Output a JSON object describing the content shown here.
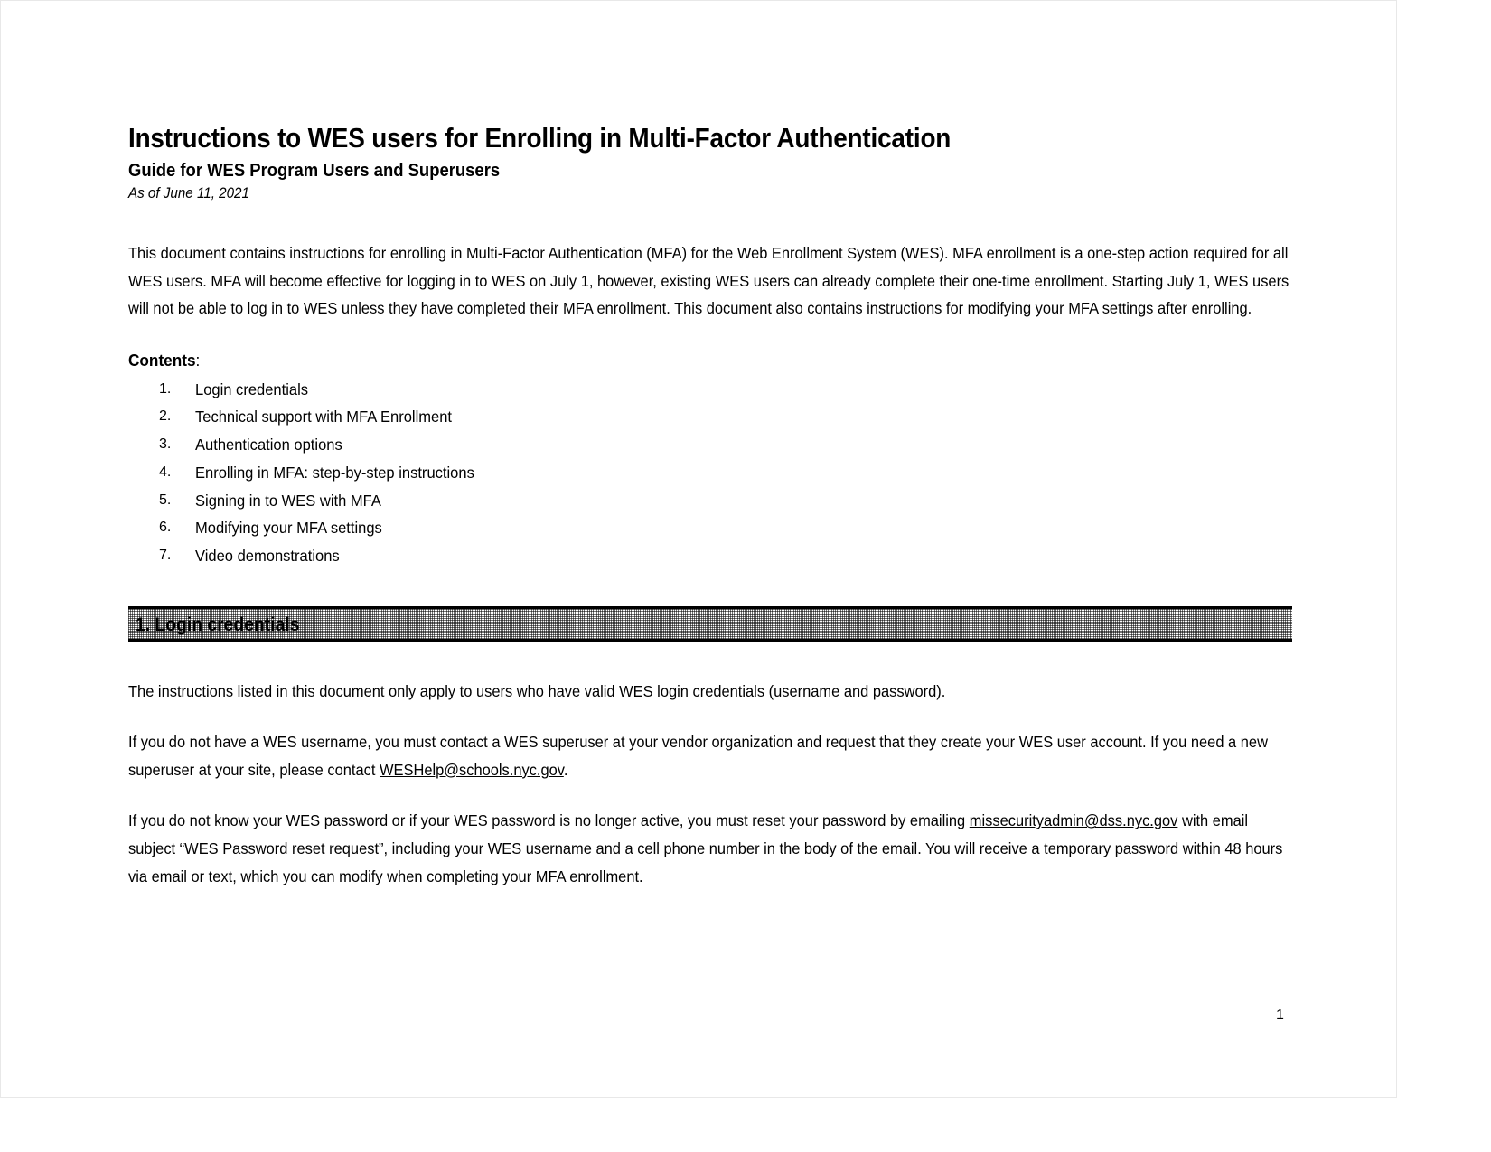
{
  "document": {
    "title": "Instructions to WES users for Enrolling in Multi-Factor Authentication",
    "subtitle": "Guide for WES Program Users and Superusers",
    "date_line": "As of June 11, 2021",
    "intro_paragraph": "This document contains instructions for enrolling in Multi-Factor Authentication (MFA) for the Web Enrollment System (WES). MFA enrollment is a one-step action required for all WES users. MFA will become effective for logging in to WES on July 1, however, existing WES users can already complete their one-time enrollment. Starting July 1, WES users will not be able to log in to WES unless they have completed their MFA enrollment. This document also contains instructions for modifying your MFA settings after enrolling.",
    "contents_label": "Contents",
    "contents_colon": ":",
    "contents": [
      {
        "num": "1.",
        "label": "Login credentials"
      },
      {
        "num": "2.",
        "label": "Technical support with MFA Enrollment"
      },
      {
        "num": "3.",
        "label": "Authentication options"
      },
      {
        "num": "4.",
        "label": "Enrolling in MFA: step-by-step instructions"
      },
      {
        "num": "5.",
        "label": "Signing in to WES with MFA"
      },
      {
        "num": "6.",
        "label": "Modifying your MFA settings"
      },
      {
        "num": "7.",
        "label": "Video demonstrations"
      }
    ],
    "section1": {
      "heading": "1. Login credentials",
      "para1": "The instructions listed in this document only apply to users who have valid WES login credentials (username and password).",
      "para2_before": "If you do not have a WES username, you must contact a WES superuser at your vendor organization and request that they create your WES user account. If you need a new superuser at your site, please contact ",
      "para2_link": "WESHelp@schools.nyc.gov",
      "para2_after": ".",
      "para3_before": "If you do not know your WES password or if your WES password is no longer active, you must reset your password by emailing ",
      "para3_link": "missecurityadmin@dss.nyc.gov",
      "para3_after": " with email subject “WES Password reset request”, including your WES username and a cell phone number in the body of the email. You will receive a temporary password within 48 hours via email or text, which you can modify when completing your MFA enrollment."
    },
    "page_number": "1"
  }
}
